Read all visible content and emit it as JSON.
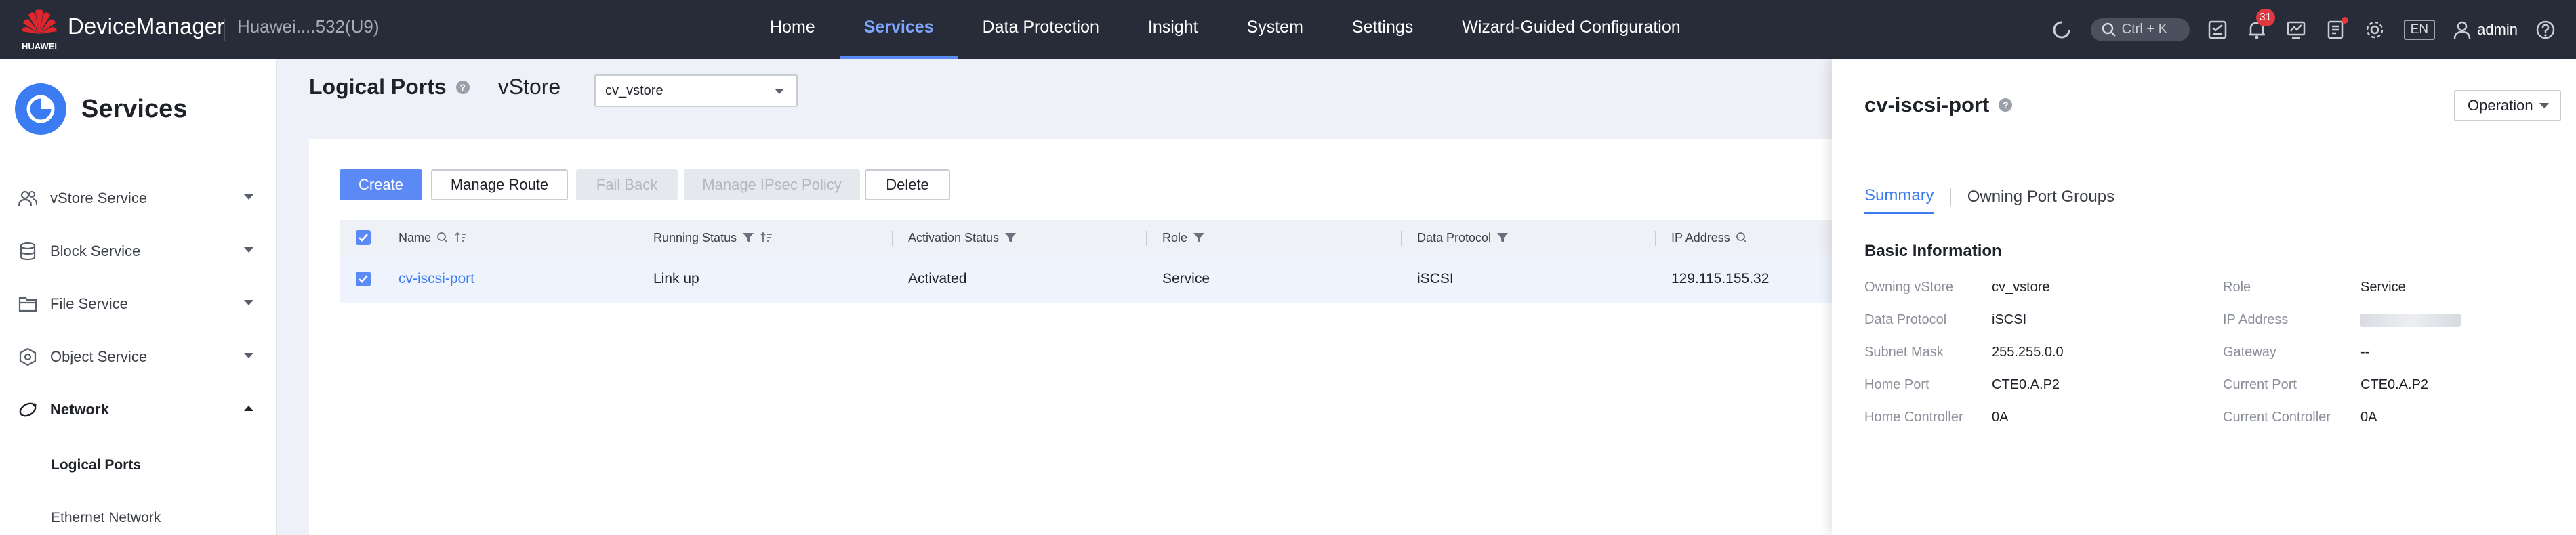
{
  "topbar": {
    "brand_word": "HUAWEI",
    "app_title": "DeviceManager",
    "device_name": "Huawei....532(U9)",
    "nav": [
      {
        "label": "Home"
      },
      {
        "label": "Services",
        "active": true
      },
      {
        "label": "Data Protection"
      },
      {
        "label": "Insight"
      },
      {
        "label": "System"
      },
      {
        "label": "Settings"
      },
      {
        "label": "Wizard-Guided Configuration"
      }
    ],
    "search_shortcut": "Ctrl + K",
    "alarm_count": "31",
    "language": "EN",
    "user": "admin"
  },
  "sidebar": {
    "title": "Services",
    "items": [
      {
        "label": "vStore Service",
        "icon": "users-icon"
      },
      {
        "label": "Block Service",
        "icon": "database-icon"
      },
      {
        "label": "File Service",
        "icon": "folder-icon"
      },
      {
        "label": "Object Service",
        "icon": "object-icon"
      },
      {
        "label": "Network",
        "icon": "network-icon",
        "expanded": true
      }
    ],
    "sub_items": [
      {
        "label": "Logical Ports",
        "active": true
      },
      {
        "label": "Ethernet Network"
      }
    ]
  },
  "main": {
    "title": "Logical Ports",
    "vstore_label": "vStore",
    "vstore_value": "cv_vstore",
    "buttons": {
      "create": "Create",
      "manage_route": "Manage Route",
      "fail_back": "Fail Back",
      "manage_ipsec": "Manage IPsec Policy",
      "delete": "Delete"
    },
    "table": {
      "columns": [
        "Name",
        "Running Status",
        "Activation Status",
        "Role",
        "Data Protocol",
        "IP Address"
      ],
      "rows": [
        {
          "name": "cv-iscsi-port",
          "running_status": "Link up",
          "activation_status": "Activated",
          "role": "Service",
          "data_protocol": "iSCSI",
          "ip_address": "129.115.155.32"
        }
      ]
    }
  },
  "panel": {
    "title": "cv-iscsi-port",
    "operation_label": "Operation",
    "tabs": [
      "Summary",
      "Owning Port Groups"
    ],
    "section_title": "Basic Information",
    "left": [
      {
        "k": "Owning vStore",
        "v": "cv_vstore"
      },
      {
        "k": "Data Protocol",
        "v": "iSCSI"
      },
      {
        "k": "Subnet Mask",
        "v": "255.255.0.0"
      },
      {
        "k": "Home Port",
        "v": "CTE0.A.P2"
      },
      {
        "k": "Home Controller",
        "v": "0A"
      }
    ],
    "right": [
      {
        "k": "Role",
        "v": "Service"
      },
      {
        "k": "IP Address",
        "v": ""
      },
      {
        "k": "Gateway",
        "v": "--"
      },
      {
        "k": "Current Port",
        "v": "CTE0.A.P2"
      },
      {
        "k": "Current Controller",
        "v": "0A"
      }
    ]
  },
  "colors": {
    "topbar_bg": "#272c38",
    "accent": "#5b8af7",
    "link": "#3b7cf2",
    "alert": "#e0383e"
  }
}
